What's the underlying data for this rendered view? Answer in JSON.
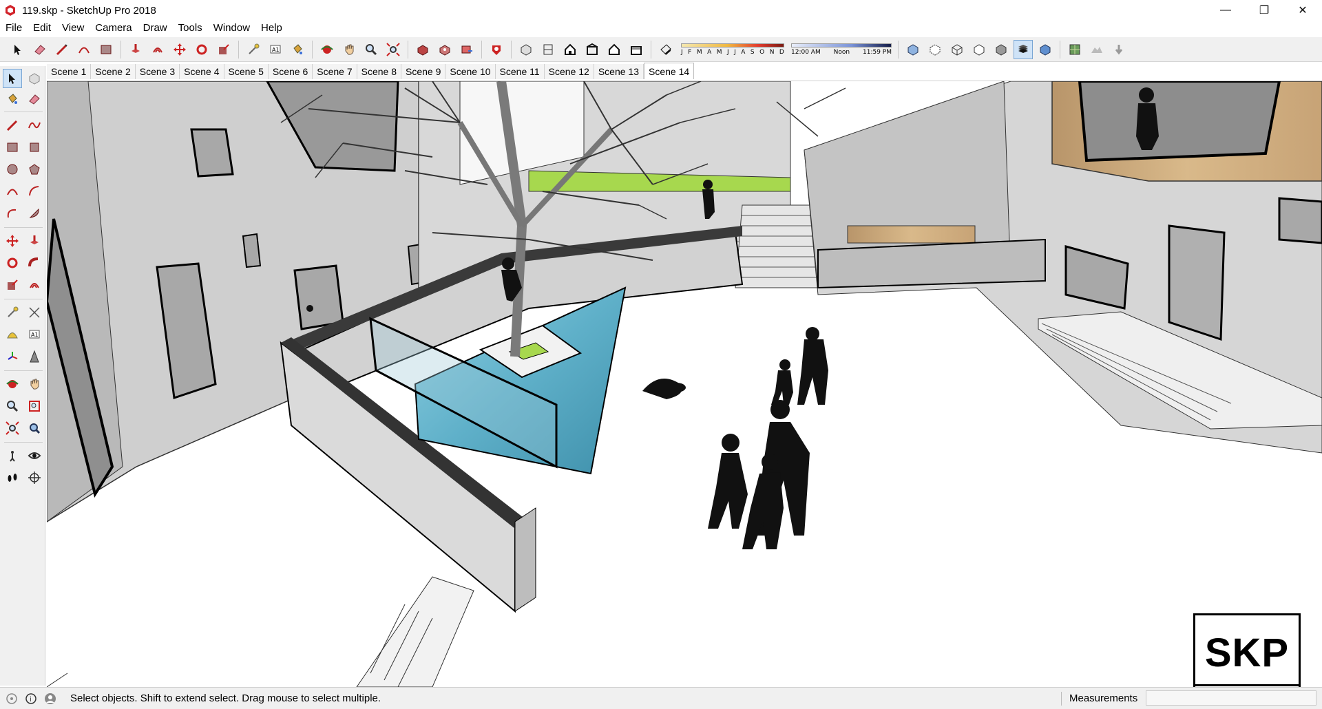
{
  "window": {
    "title": "119.skp - SketchUp Pro 2018",
    "controls": {
      "minimize": "—",
      "maximize": "❐",
      "close": "✕"
    }
  },
  "menu": [
    "File",
    "Edit",
    "View",
    "Camera",
    "Draw",
    "Tools",
    "Window",
    "Help"
  ],
  "shadow": {
    "months": [
      "J",
      "F",
      "M",
      "A",
      "M",
      "J",
      "J",
      "A",
      "S",
      "O",
      "N",
      "D"
    ],
    "time_start": "12:00 AM",
    "time_mid": "Noon",
    "time_end": "11:59 PM"
  },
  "scenes": [
    "Scene 1",
    "Scene 2",
    "Scene 3",
    "Scene 4",
    "Scene 5",
    "Scene 6",
    "Scene 7",
    "Scene 8",
    "Scene 9",
    "Scene 10",
    "Scene 11",
    "Scene 12",
    "Scene 13",
    "Scene 14"
  ],
  "active_scene": "Scene 14",
  "watermark": "SKP",
  "status": {
    "message": "Select objects. Shift to extend select. Drag mouse to select multiple.",
    "measurements_label": "Measurements",
    "measurements_value": ""
  },
  "colors": {
    "accent": "#c0392b",
    "water": "#6fb7cf",
    "grass": "#a7d84e",
    "wood": "#c9a57a",
    "wall": "#c9c9c9",
    "toolbar_bg": "#f0f0f0"
  }
}
